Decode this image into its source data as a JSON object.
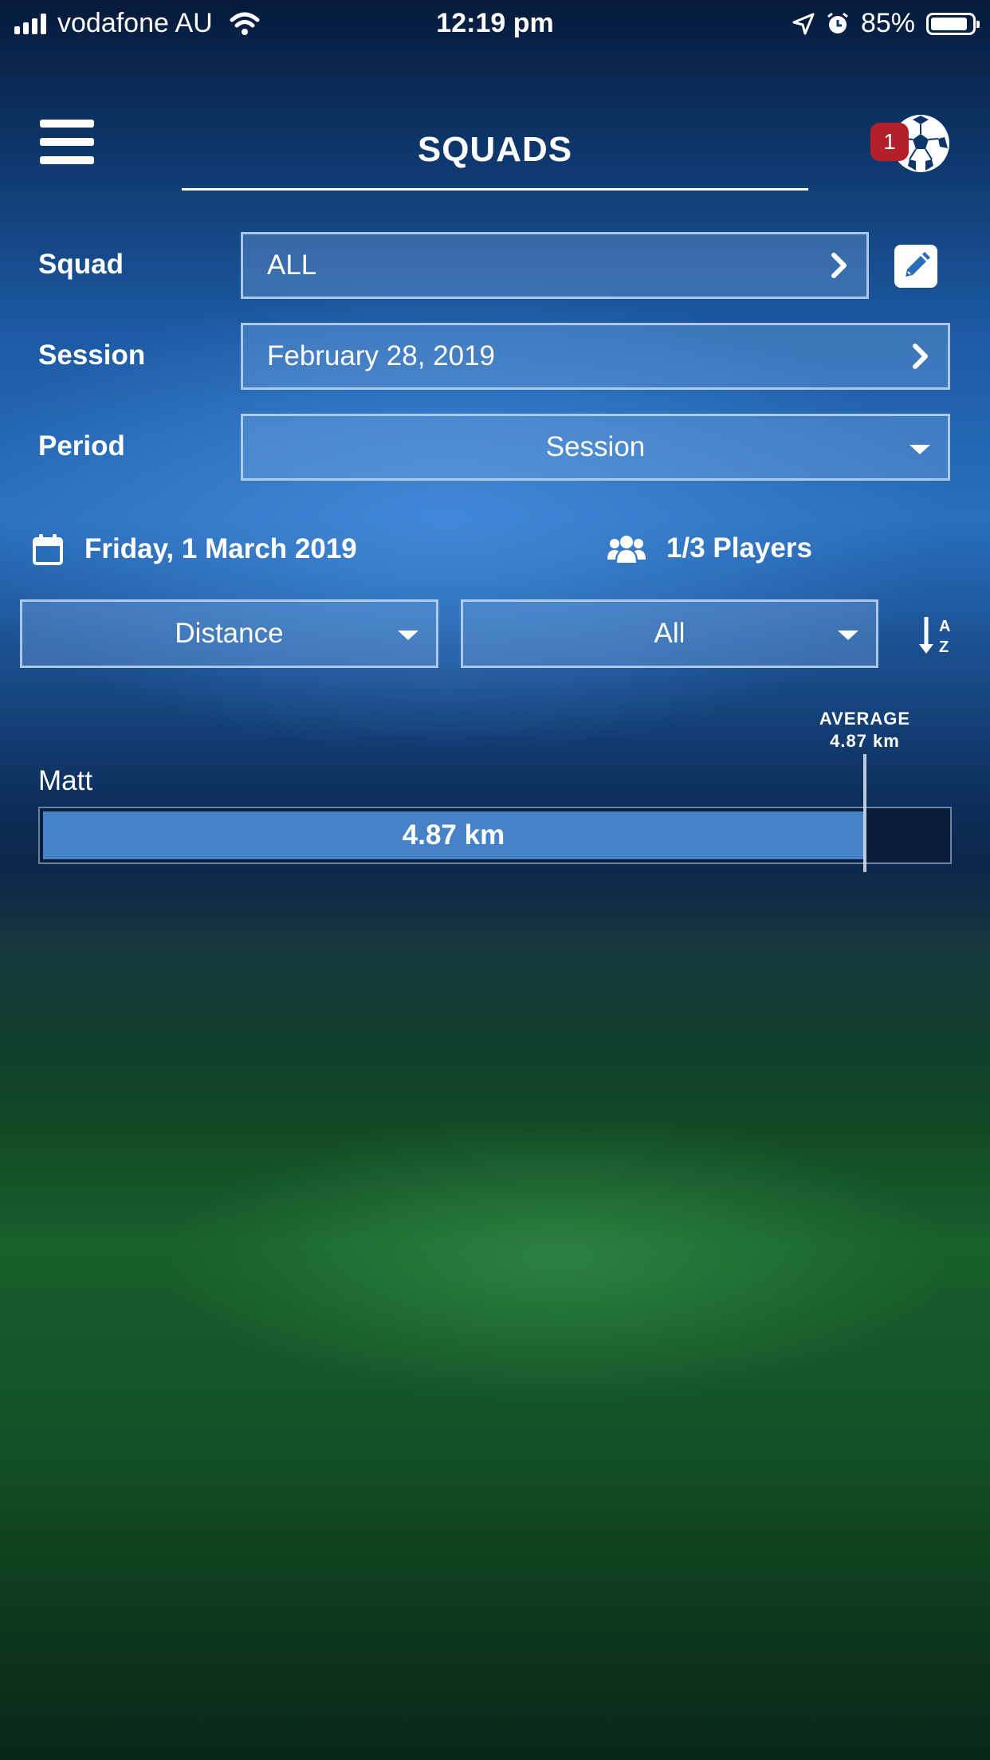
{
  "status_bar": {
    "carrier": "vodafone AU",
    "time": "12:19 pm",
    "battery": "85%"
  },
  "header": {
    "title": "SQUADS",
    "notification_count": "1"
  },
  "form": {
    "squad": {
      "label": "Squad",
      "value": "ALL"
    },
    "session": {
      "label": "Session",
      "value": "February 28, 2019"
    },
    "period": {
      "label": "Period",
      "value": "Session"
    }
  },
  "info": {
    "date": "Friday, 1 March 2019",
    "players": "1/3 Players"
  },
  "filters": {
    "metric": "Distance",
    "group": "All",
    "sort_icon": "sort-alpha-icon"
  },
  "chart_data": {
    "type": "bar",
    "orientation": "horizontal",
    "categories": [
      "Matt"
    ],
    "values": [
      4.87
    ],
    "value_labels": [
      "4.87 km"
    ],
    "unit": "km",
    "average": {
      "label": "AVERAGE",
      "value": 4.87,
      "text": "4.87 km"
    },
    "max_fraction_of_track": 0.905,
    "colors": {
      "bar": "#4682c8",
      "track": "#08192f",
      "average_line": "#dce6f5"
    }
  },
  "icons": [
    "menu-icon",
    "soccer-ball-icon",
    "edit-pencil-icon",
    "chevron-right-icon",
    "caret-down-icon",
    "calendar-icon",
    "players-group-icon",
    "sort-alpha-icon"
  ],
  "colors": {
    "badge": "#b3202a",
    "accent": "#4682c8"
  }
}
